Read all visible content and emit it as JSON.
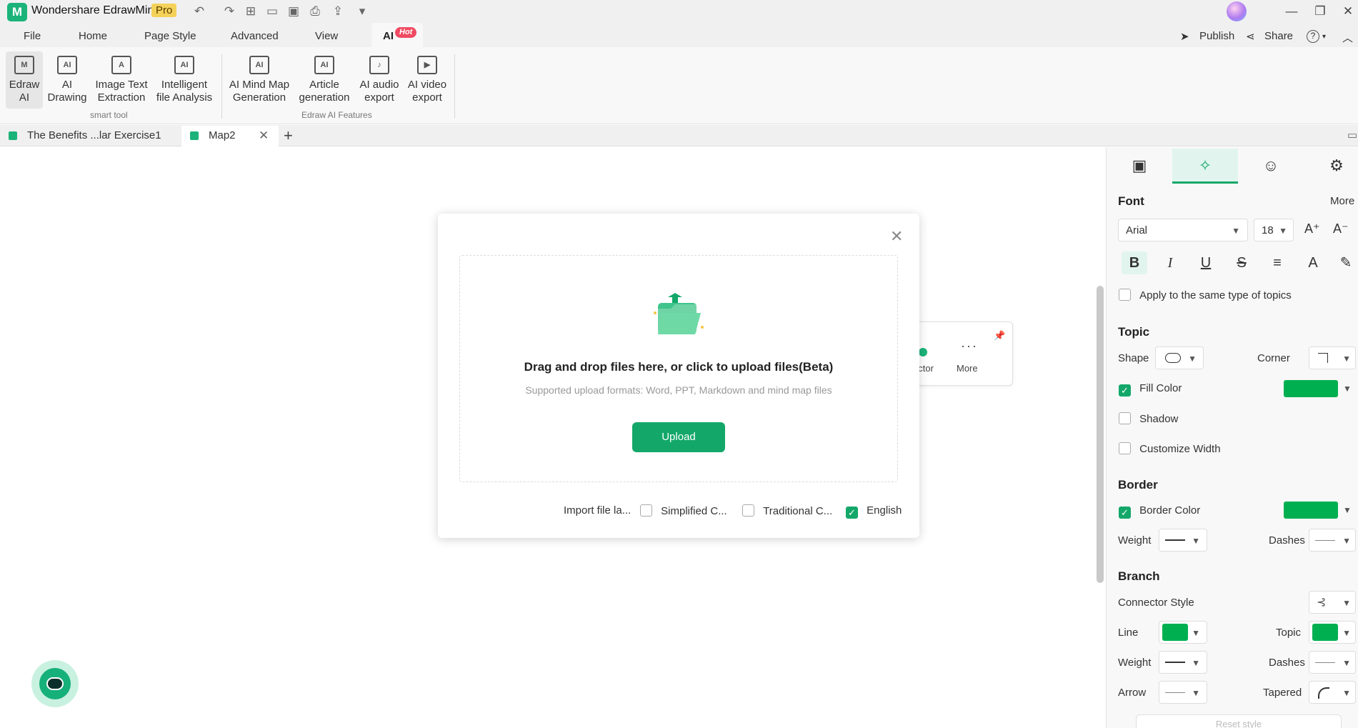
{
  "app": {
    "logo_letter": "M",
    "name": "Wondershare EdrawMind",
    "edition": "Pro"
  },
  "menus": [
    "File",
    "Home",
    "Page Style",
    "Advanced",
    "View"
  ],
  "menu_active": "AI",
  "hot_badge": "Hot",
  "right_menu": {
    "publish": "Publish",
    "share": "Share",
    "help": "?"
  },
  "ribbon": {
    "smart_tool_buttons": [
      {
        "label": "Edraw\nAI",
        "icon": "edraw-ai-icon"
      },
      {
        "label": "AI\nDrawing",
        "icon": "ai-drawing-icon"
      },
      {
        "label": "Image Text\nExtraction",
        "icon": "image-text-extraction-icon"
      },
      {
        "label": "Intelligent\nfile Analysis",
        "icon": "file-analysis-icon"
      }
    ],
    "smart_tool_label": "smart tool",
    "ai_feature_buttons": [
      {
        "label": "AI Mind Map\nGeneration",
        "icon": "ai-mindmap-icon"
      },
      {
        "label": "Article\ngeneration",
        "icon": "article-generation-icon"
      },
      {
        "label": "AI audio\nexport",
        "icon": "audio-export-icon"
      },
      {
        "label": "AI video\nexport",
        "icon": "video-export-icon"
      }
    ],
    "ai_features_label": "Edraw AI Features"
  },
  "tabs": [
    {
      "label": "The Benefits ...lar Exercise1"
    },
    {
      "label": "Map2",
      "active": true
    }
  ],
  "floating_toolbar": {
    "connector": "ector",
    "more": "More"
  },
  "dialog": {
    "title": "Drag and drop files here, or click to upload files(Beta)",
    "subtitle": "Supported upload formats: Word, PPT, Markdown and mind map files",
    "upload_button": "Upload",
    "import_label": "Import file la...",
    "languages": [
      {
        "label": "Simplified C...",
        "checked": false
      },
      {
        "label": "Traditional C...",
        "checked": false
      },
      {
        "label": "English",
        "checked": true
      }
    ]
  },
  "panel": {
    "font": {
      "title": "Font",
      "more": "More",
      "family": "Arial",
      "size": "18",
      "apply_same": "Apply to the same type of topics"
    },
    "topic": {
      "title": "Topic",
      "shape": "Shape",
      "corner": "Corner",
      "fill_color": "Fill Color",
      "shadow": "Shadow",
      "customize_width": "Customize Width"
    },
    "border": {
      "title": "Border",
      "border_color": "Border Color",
      "weight": "Weight",
      "dashes": "Dashes"
    },
    "branch": {
      "title": "Branch",
      "connector_style": "Connector Style",
      "line": "Line",
      "topic": "Topic",
      "weight": "Weight",
      "dashes": "Dashes",
      "arrow": "Arrow",
      "tapered": "Tapered"
    },
    "reset": "Reset style"
  },
  "colors": {
    "accent": "#13a86a",
    "fill": "#00b050",
    "hot": "#f04b62"
  }
}
